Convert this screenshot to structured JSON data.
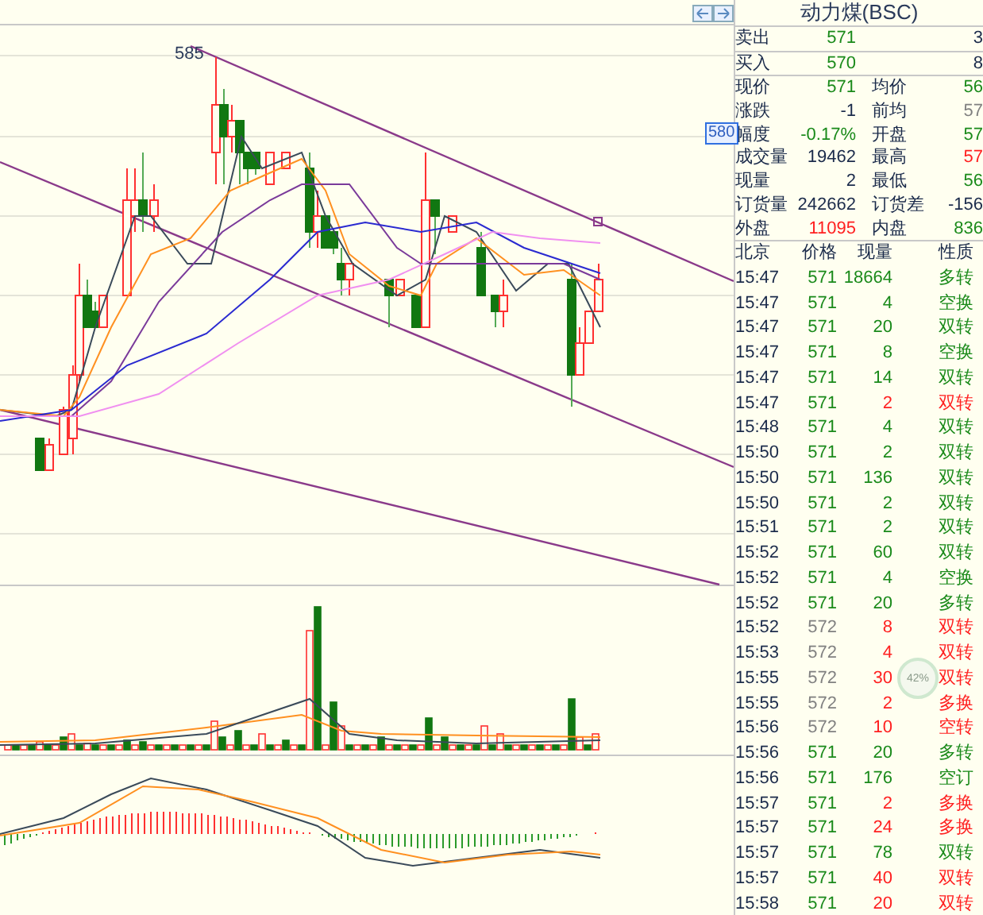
{
  "chart": {
    "high_label": "585",
    "price_tag": "580"
  },
  "quote": {
    "title": "动力煤(BSC)",
    "orders": [
      {
        "label": "卖出",
        "value": {
          "text": "571",
          "color": "#1a8a1a"
        },
        "extra": {
          "text": "3",
          "color": "#1a2a4a"
        }
      },
      {
        "label": "买入",
        "value": {
          "text": "570",
          "color": "#1a8a1a"
        },
        "extra": {
          "text": "8",
          "color": "#1a2a4a"
        }
      }
    ],
    "stats": [
      {
        "label": "现价",
        "value": {
          "text": "571",
          "color": "#1a8a1a"
        },
        "label2": "均价",
        "value2": {
          "text": "56",
          "color": "#1a8a1a"
        }
      },
      {
        "label": "涨跌",
        "value": {
          "text": "-1",
          "color": "#1a2a4a"
        },
        "label2": "前均",
        "value2": {
          "text": "57",
          "color": "#808080"
        }
      },
      {
        "label": "幅度",
        "value": {
          "text": "-0.17%",
          "color": "#1a8a1a"
        },
        "label2": "开盘",
        "value2": {
          "text": "57",
          "color": "#1a8a1a"
        }
      },
      {
        "label": "成交量",
        "value": {
          "text": "19462",
          "color": "#1a2a4a"
        },
        "label2": "最高",
        "value2": {
          "text": "57",
          "color": "#ff2020"
        }
      },
      {
        "label": "现量",
        "value": {
          "text": "2",
          "color": "#1a2a4a"
        },
        "label2": "最低",
        "value2": {
          "text": "56",
          "color": "#1a8a1a"
        }
      },
      {
        "label": "订货量",
        "value": {
          "text": "242662",
          "color": "#1a2a4a"
        },
        "label2": "订货差",
        "value2": {
          "text": "-156",
          "color": "#1a2a4a"
        }
      },
      {
        "label": "外盘",
        "value": {
          "text": "11095",
          "color": "#ff2020"
        },
        "label2": "内盘",
        "value2": {
          "text": "836",
          "color": "#1a8a1a"
        }
      }
    ]
  },
  "ticks": {
    "columns": [
      "北京",
      "价格",
      "现量",
      "性质"
    ],
    "rows": [
      {
        "time": "15:47",
        "price": {
          "text": "571",
          "color": "#1a8a1a"
        },
        "volume": "18664",
        "nature": "多转",
        "color": "#1a8a1a"
      },
      {
        "time": "15:47",
        "price": {
          "text": "571",
          "color": "#1a8a1a"
        },
        "volume": "4",
        "nature": "空换",
        "color": "#1a8a1a"
      },
      {
        "time": "15:47",
        "price": {
          "text": "571",
          "color": "#1a8a1a"
        },
        "volume": "20",
        "nature": "双转",
        "color": "#1a8a1a"
      },
      {
        "time": "15:47",
        "price": {
          "text": "571",
          "color": "#1a8a1a"
        },
        "volume": "8",
        "nature": "空换",
        "color": "#1a8a1a"
      },
      {
        "time": "15:47",
        "price": {
          "text": "571",
          "color": "#1a8a1a"
        },
        "volume": "14",
        "nature": "双转",
        "color": "#1a8a1a"
      },
      {
        "time": "15:47",
        "price": {
          "text": "571",
          "color": "#1a8a1a"
        },
        "volume": "2",
        "nature": "双转",
        "color": "#ff2020"
      },
      {
        "time": "15:48",
        "price": {
          "text": "571",
          "color": "#1a8a1a"
        },
        "volume": "4",
        "nature": "双转",
        "color": "#1a8a1a"
      },
      {
        "time": "15:50",
        "price": {
          "text": "571",
          "color": "#1a8a1a"
        },
        "volume": "2",
        "nature": "双转",
        "color": "#1a8a1a"
      },
      {
        "time": "15:50",
        "price": {
          "text": "571",
          "color": "#1a8a1a"
        },
        "volume": "136",
        "nature": "双转",
        "color": "#1a8a1a"
      },
      {
        "time": "15:50",
        "price": {
          "text": "571",
          "color": "#1a8a1a"
        },
        "volume": "2",
        "nature": "双转",
        "color": "#1a8a1a"
      },
      {
        "time": "15:51",
        "price": {
          "text": "571",
          "color": "#1a8a1a"
        },
        "volume": "2",
        "nature": "双转",
        "color": "#1a8a1a"
      },
      {
        "time": "15:52",
        "price": {
          "text": "571",
          "color": "#1a8a1a"
        },
        "volume": "60",
        "nature": "双转",
        "color": "#1a8a1a"
      },
      {
        "time": "15:52",
        "price": {
          "text": "571",
          "color": "#1a8a1a"
        },
        "volume": "4",
        "nature": "空换",
        "color": "#1a8a1a"
      },
      {
        "time": "15:52",
        "price": {
          "text": "571",
          "color": "#1a8a1a"
        },
        "volume": "20",
        "nature": "多转",
        "color": "#1a8a1a"
      },
      {
        "time": "15:52",
        "price": {
          "text": "572",
          "color": "#808080"
        },
        "volume": "8",
        "nature": "双转",
        "color": "#ff2020"
      },
      {
        "time": "15:53",
        "price": {
          "text": "572",
          "color": "#808080"
        },
        "volume": "4",
        "nature": "双转",
        "color": "#ff2020"
      },
      {
        "time": "15:55",
        "price": {
          "text": "572",
          "color": "#808080"
        },
        "volume": "30",
        "nature": "双转",
        "color": "#ff2020"
      },
      {
        "time": "15:55",
        "price": {
          "text": "572",
          "color": "#808080"
        },
        "volume": "2",
        "nature": "多换",
        "color": "#ff2020"
      },
      {
        "time": "15:56",
        "price": {
          "text": "572",
          "color": "#808080"
        },
        "volume": "10",
        "nature": "空转",
        "color": "#ff2020"
      },
      {
        "time": "15:56",
        "price": {
          "text": "571",
          "color": "#1a8a1a"
        },
        "volume": "20",
        "nature": "多转",
        "color": "#1a8a1a"
      },
      {
        "time": "15:56",
        "price": {
          "text": "571",
          "color": "#1a8a1a"
        },
        "volume": "176",
        "nature": "空订",
        "color": "#1a8a1a"
      },
      {
        "time": "15:57",
        "price": {
          "text": "571",
          "color": "#1a8a1a"
        },
        "volume": "2",
        "nature": "多换",
        "color": "#ff2020"
      },
      {
        "time": "15:57",
        "price": {
          "text": "571",
          "color": "#1a8a1a"
        },
        "volume": "24",
        "nature": "多换",
        "color": "#ff2020"
      },
      {
        "time": "15:57",
        "price": {
          "text": "571",
          "color": "#1a8a1a"
        },
        "volume": "78",
        "nature": "双转",
        "color": "#1a8a1a"
      },
      {
        "time": "15:57",
        "price": {
          "text": "571",
          "color": "#1a8a1a"
        },
        "volume": "40",
        "nature": "双转",
        "color": "#ff2020"
      },
      {
        "time": "15:58",
        "price": {
          "text": "571",
          "color": "#1a8a1a"
        },
        "volume": "20",
        "nature": "双转",
        "color": "#ff2020"
      }
    ]
  },
  "speed_widget": {
    "percent": "42%"
  }
}
